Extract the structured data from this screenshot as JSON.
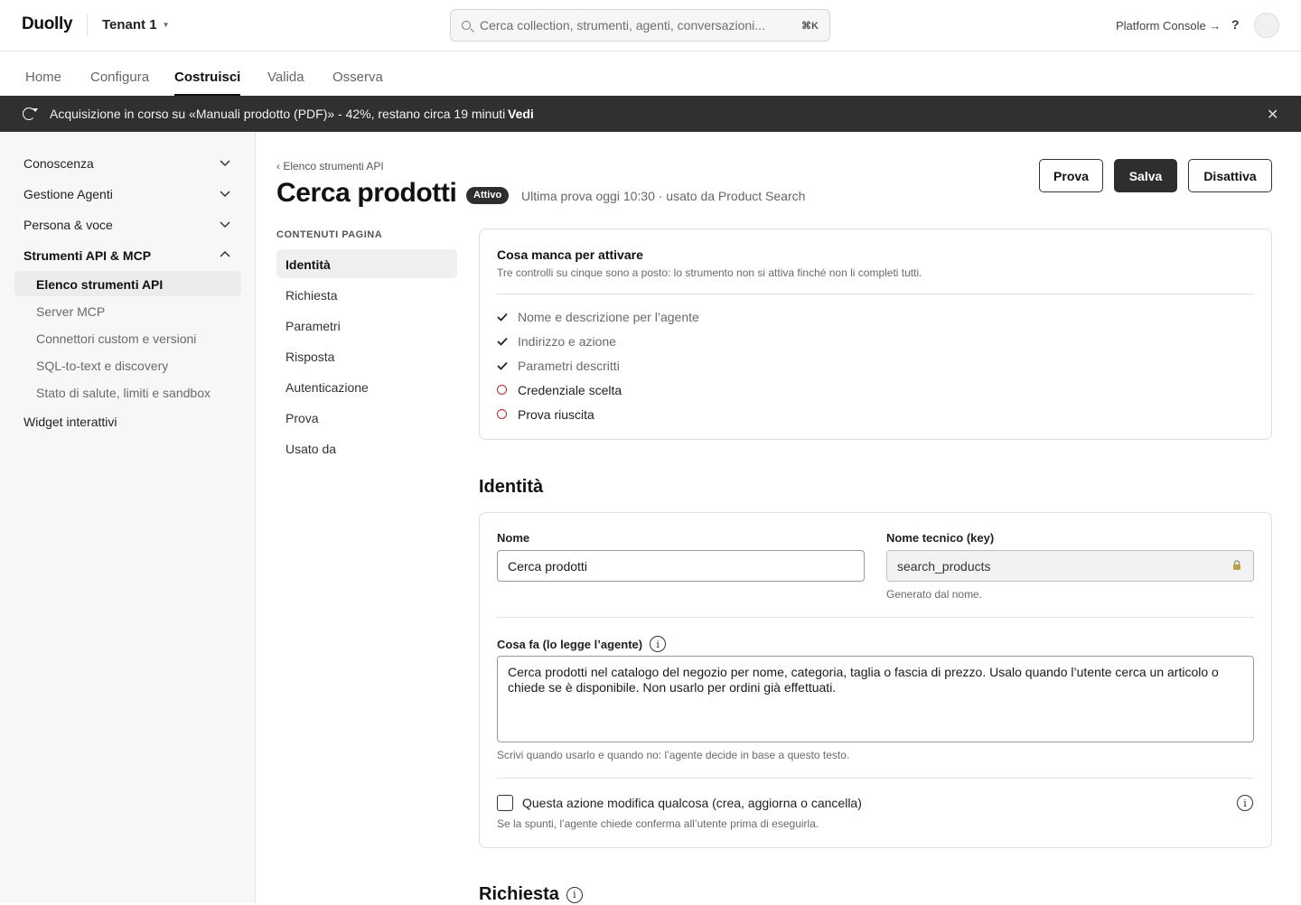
{
  "app": {
    "logo": "Duolly",
    "tenant": "Tenant 1"
  },
  "search": {
    "placeholder": "Cerca collection, strumenti, agenti, conversazioni...",
    "shortcut": "⌘K"
  },
  "header_right": {
    "platform_console": "Platform Console →",
    "help": "?"
  },
  "nav_tabs": [
    {
      "label": "Home",
      "active": false
    },
    {
      "label": "Configura",
      "active": false
    },
    {
      "label": "Costruisci",
      "active": true
    },
    {
      "label": "Valida",
      "active": false
    },
    {
      "label": "Osserva",
      "active": false
    }
  ],
  "banner": {
    "message": "Acquisizione in corso su «Manuali prodotto (PDF)» - 42%, restano circa 19 minuti",
    "progress_percent": 42,
    "link": "Vedi",
    "close": "✕"
  },
  "sidebar": {
    "groups": [
      {
        "label": "Conoscenza",
        "expanded": false
      },
      {
        "label": "Gestione Agenti",
        "expanded": false
      },
      {
        "label": "Persona & voce",
        "expanded": false
      },
      {
        "label": "Strumenti API & MCP",
        "expanded": true
      },
      {
        "label": "Widget interattivi",
        "expanded": false
      }
    ],
    "sub_items": [
      {
        "label": "Elenco strumenti API",
        "active": true
      },
      {
        "label": "Server MCP",
        "active": false
      },
      {
        "label": "Connettori custom e versioni",
        "active": false
      },
      {
        "label": "SQL-to-text e discovery",
        "active": false
      },
      {
        "label": "Stato di salute, limiti e sandbox",
        "active": false
      }
    ]
  },
  "page": {
    "breadcrumb": "‹  Elenco strumenti API",
    "title": "Cerca prodotti",
    "status_badge": "Attivo",
    "meta": "Ultima prova oggi 10:30 · usato da Product Search",
    "actions": {
      "try": "Prova",
      "save": "Salva",
      "deactivate": "Disattiva"
    }
  },
  "toc": {
    "heading": "CONTENUTI PAGINA",
    "items": [
      "Identità",
      "Richiesta",
      "Parametri",
      "Risposta",
      "Autenticazione",
      "Prova",
      "Usato da"
    ],
    "active_index": 0
  },
  "checklist": {
    "title": "Cosa manca per attivare",
    "subtitle": "Tre controlli su cinque sono a posto: lo strumento non si attiva finché non li completi tutti.",
    "items": [
      {
        "label": "Nome e descrizione per l’agente",
        "done": true
      },
      {
        "label": "Indirizzo e azione",
        "done": true
      },
      {
        "label": "Parametri descritti",
        "done": true
      },
      {
        "label": "Credenziale scelta",
        "done": false
      },
      {
        "label": "Prova riuscita",
        "done": false
      }
    ]
  },
  "identity": {
    "section_title": "Identità",
    "name_label": "Nome",
    "name_value": "Cerca prodotti",
    "key_label": "Nome tecnico (key)",
    "key_value": "search_products",
    "key_hint": "Generato dal nome.",
    "desc_label": "Cosa fa (lo legge l’agente)",
    "desc_value": "Cerca prodotti nel catalogo del negozio per nome, categoria, taglia o fascia di prezzo. Usalo quando l’utente cerca un articolo o chiede se è disponibile. Non usarlo per ordini già effettuati.",
    "desc_hint": "Scrivi quando usarlo e quando no: l’agente decide in base a questo testo.",
    "modifies_label": "Questa azione modifica qualcosa (crea, aggiorna o cancella)",
    "modifies_checked": false,
    "modifies_hint": "Se la spunti, l’agente chiede conferma all’utente prima di eseguirla."
  },
  "request": {
    "section_title": "Richiesta"
  },
  "info_glyph": "i",
  "colors": {
    "banner_bg": "#303030",
    "todo_ring": "#b3282d",
    "accent_dark": "#2e2e2e"
  }
}
